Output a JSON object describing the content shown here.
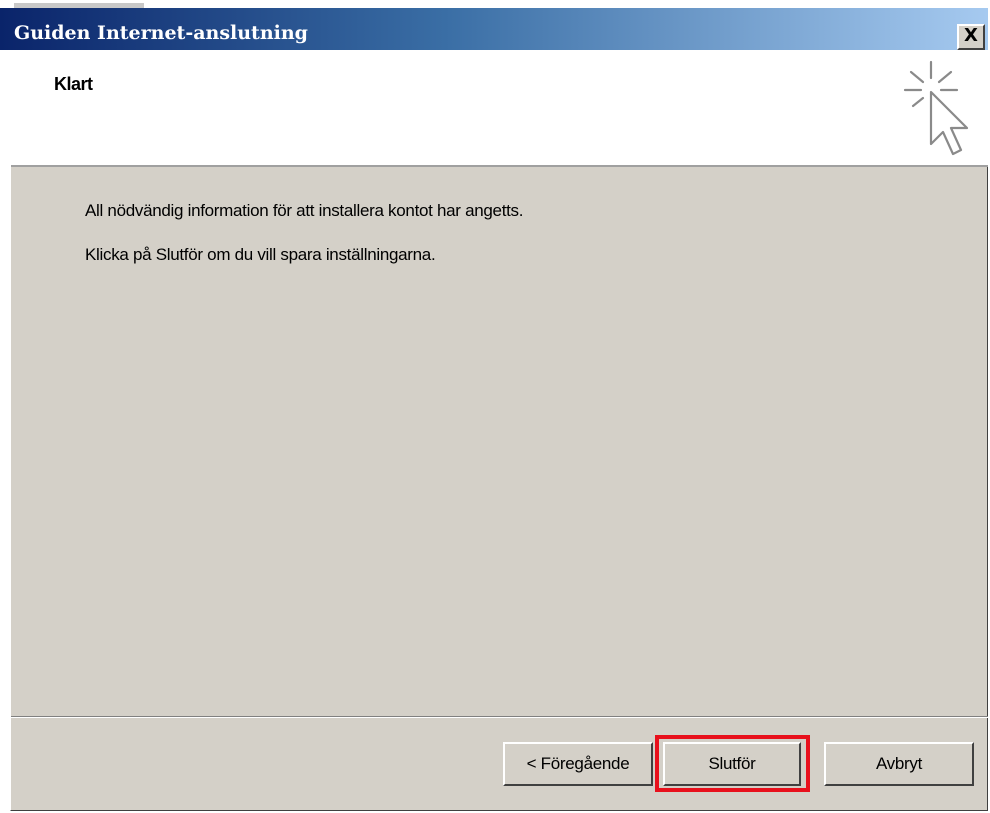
{
  "window": {
    "title": "Guiden Internet-anslutning",
    "close_label": "X"
  },
  "header": {
    "title": "Klart",
    "icon": "cursor-click-icon"
  },
  "content": {
    "line1": "All nödvändig information för att installera kontot har angetts.",
    "line2": "Klicka på Slutför om du vill spara inställningarna."
  },
  "buttons": {
    "back": "< Föregående",
    "finish": "Slutför",
    "cancel": "Avbryt"
  },
  "colors": {
    "titlebar_start": "#0a246a",
    "titlebar_end": "#a6caf0",
    "dialog_bg": "#d4d0c8",
    "highlight": "#e8101c"
  }
}
